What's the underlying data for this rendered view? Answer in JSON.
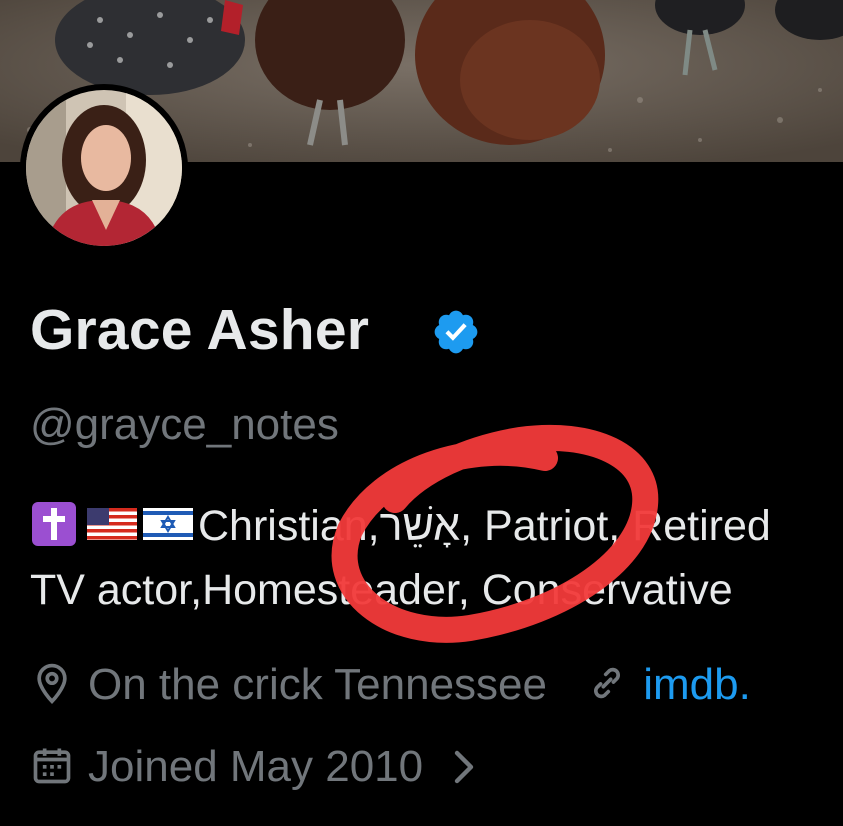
{
  "profile": {
    "display_name": "Grace Asher",
    "handle": "@grayce_notes",
    "bio_line1_text": "Christian,אָשֵׁר, Patriot, Retired",
    "bio_line2": "TV actor,Homesteader, Conservative",
    "location": "On the crick Tennessee",
    "website": "imdb.",
    "joined": "Joined May 2010"
  },
  "icons": {
    "verified": "verified-badge-icon",
    "location": "location-pin-icon",
    "link": "link-icon",
    "calendar": "calendar-icon",
    "chevron": "chevron-right-icon",
    "bio_emojis": [
      "latin-cross-emoji",
      "us-flag-emoji",
      "israel-flag-emoji"
    ]
  },
  "colors": {
    "background": "#000000",
    "name": "#e7e9ea",
    "secondary": "#71767b",
    "link": "#1d9bf0",
    "verified": "#1d9bf0",
    "annotation": "#f23a3a"
  }
}
